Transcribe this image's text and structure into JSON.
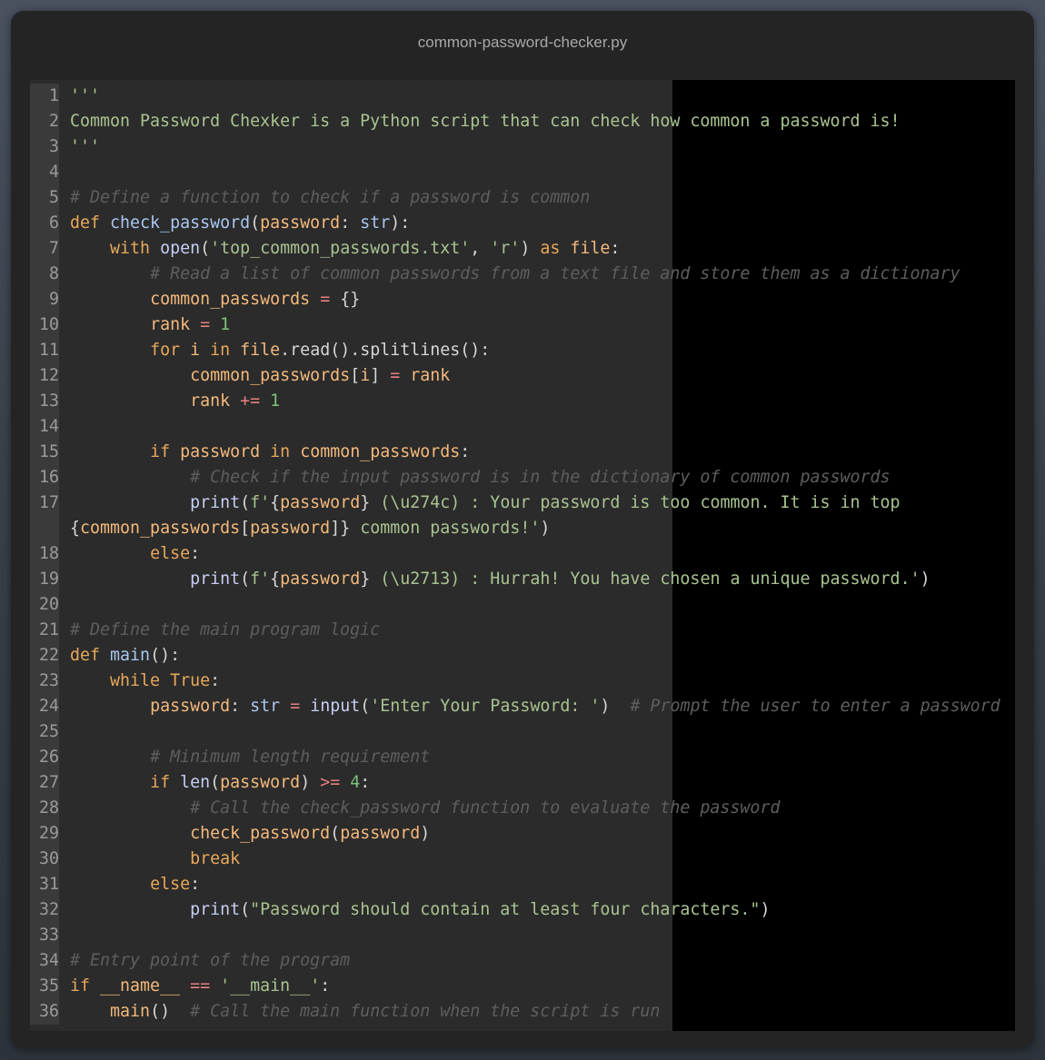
{
  "window": {
    "title": "common-password-checker.py"
  },
  "editor": {
    "language": "python",
    "lines": [
      {
        "n": "1",
        "tokens": [
          [
            "str",
            "'''"
          ]
        ]
      },
      {
        "n": "2",
        "tokens": [
          [
            "str",
            "Common Password Chexker is a Python script that can check how common a password is!"
          ]
        ]
      },
      {
        "n": "3",
        "tokens": [
          [
            "str",
            "'''"
          ]
        ]
      },
      {
        "n": "4",
        "tokens": []
      },
      {
        "n": "5",
        "tokens": [
          [
            "cm",
            "# Define a function to check if a password is common"
          ]
        ]
      },
      {
        "n": "6",
        "tokens": [
          [
            "kw",
            "def "
          ],
          [
            "fn",
            "check_password"
          ],
          [
            "pl",
            "("
          ],
          [
            "var",
            "password"
          ],
          [
            "pl",
            ": "
          ],
          [
            "ty",
            "str"
          ],
          [
            "pl",
            "):"
          ]
        ]
      },
      {
        "n": "7",
        "tokens": [
          [
            "pl",
            "    "
          ],
          [
            "kw",
            "with "
          ],
          [
            "bi",
            "open"
          ],
          [
            "pl",
            "("
          ],
          [
            "str",
            "'top_common_passwords.txt'"
          ],
          [
            "pl",
            ", "
          ],
          [
            "str",
            "'r'"
          ],
          [
            "pl",
            ") "
          ],
          [
            "kw",
            "as "
          ],
          [
            "var",
            "file"
          ],
          [
            "pl",
            ":"
          ]
        ]
      },
      {
        "n": "8",
        "tokens": [
          [
            "pl",
            "        "
          ],
          [
            "cm",
            "# Read a list of common passwords from a text file and store them as a dictionary"
          ]
        ]
      },
      {
        "n": "9",
        "tokens": [
          [
            "pl",
            "        "
          ],
          [
            "var",
            "common_passwords"
          ],
          [
            "pl",
            " "
          ],
          [
            "op",
            "="
          ],
          [
            "pl",
            " {}"
          ]
        ]
      },
      {
        "n": "10",
        "tokens": [
          [
            "pl",
            "        "
          ],
          [
            "var",
            "rank"
          ],
          [
            "pl",
            " "
          ],
          [
            "op",
            "="
          ],
          [
            "pl",
            " "
          ],
          [
            "num",
            "1"
          ]
        ]
      },
      {
        "n": "11",
        "tokens": [
          [
            "pl",
            "        "
          ],
          [
            "kw",
            "for "
          ],
          [
            "var",
            "i"
          ],
          [
            "kw",
            " in "
          ],
          [
            "var",
            "file"
          ],
          [
            "pl",
            ".read().splitlines():"
          ]
        ]
      },
      {
        "n": "12",
        "tokens": [
          [
            "pl",
            "            "
          ],
          [
            "var",
            "common_passwords"
          ],
          [
            "pl",
            "["
          ],
          [
            "var",
            "i"
          ],
          [
            "pl",
            "] "
          ],
          [
            "op",
            "="
          ],
          [
            "pl",
            " "
          ],
          [
            "var",
            "rank"
          ]
        ]
      },
      {
        "n": "13",
        "tokens": [
          [
            "pl",
            "            "
          ],
          [
            "var",
            "rank"
          ],
          [
            "pl",
            " "
          ],
          [
            "op",
            "+="
          ],
          [
            "pl",
            " "
          ],
          [
            "num",
            "1"
          ]
        ]
      },
      {
        "n": "14",
        "tokens": []
      },
      {
        "n": "15",
        "tokens": [
          [
            "pl",
            "        "
          ],
          [
            "kw",
            "if "
          ],
          [
            "var",
            "password"
          ],
          [
            "kw",
            " in "
          ],
          [
            "var",
            "common_passwords"
          ],
          [
            "pl",
            ":"
          ]
        ]
      },
      {
        "n": "16",
        "tokens": [
          [
            "pl",
            "            "
          ],
          [
            "cm",
            "# Check if the input password is in the dictionary of common passwords"
          ]
        ]
      },
      {
        "n": "17",
        "tokens": [
          [
            "pl",
            "            "
          ],
          [
            "bi",
            "print"
          ],
          [
            "pl",
            "("
          ],
          [
            "str",
            "f'"
          ],
          [
            "pl",
            "{"
          ],
          [
            "var",
            "password"
          ],
          [
            "pl",
            "}"
          ],
          [
            "str",
            " (\\u274c) : Your password is too common. It is in top"
          ]
        ]
      },
      {
        "n": "",
        "tokens": [
          [
            "pl",
            "{"
          ],
          [
            "var",
            "common_passwords"
          ],
          [
            "pl",
            "["
          ],
          [
            "var",
            "password"
          ],
          [
            "pl",
            "]}"
          ],
          [
            "str",
            " common passwords!'"
          ],
          [
            "pl",
            ")"
          ]
        ]
      },
      {
        "n": "18",
        "tokens": [
          [
            "pl",
            "        "
          ],
          [
            "kw",
            "else"
          ],
          [
            "pl",
            ":"
          ]
        ]
      },
      {
        "n": "19",
        "tokens": [
          [
            "pl",
            "            "
          ],
          [
            "bi",
            "print"
          ],
          [
            "pl",
            "("
          ],
          [
            "str",
            "f'"
          ],
          [
            "pl",
            "{"
          ],
          [
            "var",
            "password"
          ],
          [
            "pl",
            "}"
          ],
          [
            "str",
            " (\\u2713) : Hurrah! You have chosen a unique password.'"
          ],
          [
            "pl",
            ")"
          ]
        ]
      },
      {
        "n": "20",
        "tokens": []
      },
      {
        "n": "21",
        "tokens": [
          [
            "cm",
            "# Define the main program logic"
          ]
        ]
      },
      {
        "n": "22",
        "tokens": [
          [
            "kw",
            "def "
          ],
          [
            "fn",
            "main"
          ],
          [
            "pl",
            "():"
          ]
        ]
      },
      {
        "n": "23",
        "tokens": [
          [
            "pl",
            "    "
          ],
          [
            "kw",
            "while "
          ],
          [
            "kw",
            "True"
          ],
          [
            "pl",
            ":"
          ]
        ]
      },
      {
        "n": "24",
        "tokens": [
          [
            "pl",
            "        "
          ],
          [
            "var",
            "password"
          ],
          [
            "pl",
            ": "
          ],
          [
            "ty",
            "str"
          ],
          [
            "pl",
            " "
          ],
          [
            "op",
            "="
          ],
          [
            "pl",
            " "
          ],
          [
            "bi",
            "input"
          ],
          [
            "pl",
            "("
          ],
          [
            "str",
            "'Enter Your Password: '"
          ],
          [
            "pl",
            ")  "
          ],
          [
            "cm",
            "# Prompt the user to enter a password"
          ]
        ]
      },
      {
        "n": "25",
        "tokens": []
      },
      {
        "n": "26",
        "tokens": [
          [
            "pl",
            "        "
          ],
          [
            "cm",
            "# Minimum length requirement"
          ]
        ]
      },
      {
        "n": "27",
        "tokens": [
          [
            "pl",
            "        "
          ],
          [
            "kw",
            "if "
          ],
          [
            "bi",
            "len"
          ],
          [
            "pl",
            "("
          ],
          [
            "var",
            "password"
          ],
          [
            "pl",
            ") "
          ],
          [
            "op",
            ">="
          ],
          [
            "pl",
            " "
          ],
          [
            "num",
            "4"
          ],
          [
            "pl",
            ":"
          ]
        ]
      },
      {
        "n": "28",
        "tokens": [
          [
            "pl",
            "            "
          ],
          [
            "cm",
            "# Call the check_password function to evaluate the password"
          ]
        ]
      },
      {
        "n": "29",
        "tokens": [
          [
            "pl",
            "            "
          ],
          [
            "var",
            "check_password"
          ],
          [
            "pl",
            "("
          ],
          [
            "var",
            "password"
          ],
          [
            "pl",
            ")"
          ]
        ]
      },
      {
        "n": "30",
        "tokens": [
          [
            "pl",
            "            "
          ],
          [
            "kw",
            "break"
          ]
        ]
      },
      {
        "n": "31",
        "tokens": [
          [
            "pl",
            "        "
          ],
          [
            "kw",
            "else"
          ],
          [
            "pl",
            ":"
          ]
        ]
      },
      {
        "n": "32",
        "tokens": [
          [
            "pl",
            "            "
          ],
          [
            "bi",
            "print"
          ],
          [
            "pl",
            "("
          ],
          [
            "str",
            "\"Password should contain at least four characters.\""
          ],
          [
            "pl",
            ")"
          ]
        ]
      },
      {
        "n": "33",
        "tokens": []
      },
      {
        "n": "34",
        "tokens": [
          [
            "cm",
            "# Entry point of the program"
          ]
        ]
      },
      {
        "n": "35",
        "tokens": [
          [
            "kw",
            "if "
          ],
          [
            "var",
            "__name__"
          ],
          [
            "pl",
            " "
          ],
          [
            "op",
            "=="
          ],
          [
            "pl",
            " "
          ],
          [
            "str",
            "'__main__'"
          ],
          [
            "pl",
            ":"
          ]
        ]
      },
      {
        "n": "36",
        "tokens": [
          [
            "pl",
            "    "
          ],
          [
            "var",
            "main"
          ],
          [
            "pl",
            "()  "
          ],
          [
            "cm",
            "# Call the main function when the script is run"
          ]
        ]
      }
    ]
  },
  "colors": {
    "keyword": "#e8a85a",
    "string": "#a9c391",
    "comment": "#5e5e5e",
    "number": "#7ec27a",
    "variable": "#f4b97c",
    "operator": "#e98080",
    "builtin": "#c6cef4"
  }
}
